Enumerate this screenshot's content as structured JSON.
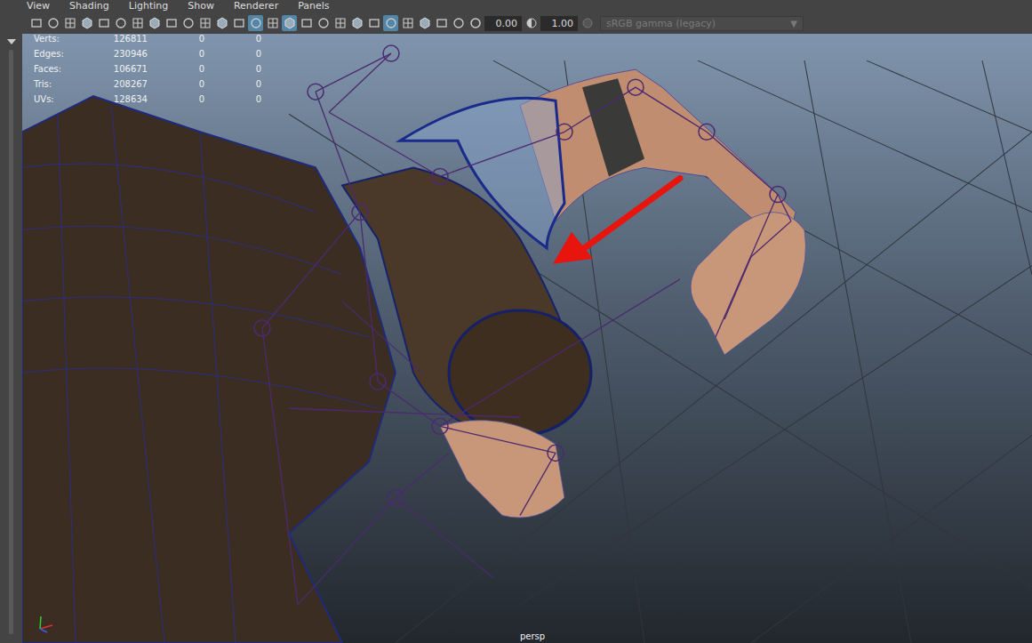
{
  "menu": [
    "View",
    "Shading",
    "Lighting",
    "Show",
    "Renderer",
    "Panels"
  ],
  "toolbar": {
    "buttons": [
      {
        "selected": false
      },
      {
        "selected": false
      },
      {
        "selected": false
      },
      {
        "selected": false
      },
      {
        "selected": false
      },
      {
        "selected": false
      },
      {
        "selected": false
      },
      {
        "selected": false
      },
      {
        "selected": false
      },
      {
        "selected": false
      },
      {
        "selected": false
      },
      {
        "selected": false
      },
      {
        "selected": false
      },
      {
        "selected": true
      },
      {
        "selected": false
      },
      {
        "selected": true
      },
      {
        "selected": false
      },
      {
        "selected": false
      },
      {
        "selected": false
      },
      {
        "selected": false
      },
      {
        "selected": false
      },
      {
        "selected": true
      },
      {
        "selected": false
      },
      {
        "selected": false
      },
      {
        "selected": false
      },
      {
        "selected": false
      },
      {
        "selected": false
      },
      {
        "selected": false
      }
    ],
    "exposure": "0.00",
    "gamma": "1.00",
    "colorspace": {
      "value": "sRGB gamma (legacy)",
      "arrow": "▼",
      "disabled": true
    }
  },
  "hud": {
    "rows": [
      {
        "label": "Verts:",
        "values": [
          "126811",
          "0",
          "0"
        ]
      },
      {
        "label": "Edges:",
        "values": [
          "230946",
          "0",
          "0"
        ]
      },
      {
        "label": "Faces:",
        "values": [
          "106671",
          "0",
          "0"
        ]
      },
      {
        "label": "Tris:",
        "values": [
          "208267",
          "0",
          "0"
        ]
      },
      {
        "label": "UVs:",
        "values": [
          "128634",
          "0",
          "0"
        ]
      }
    ]
  },
  "camera": "persp"
}
